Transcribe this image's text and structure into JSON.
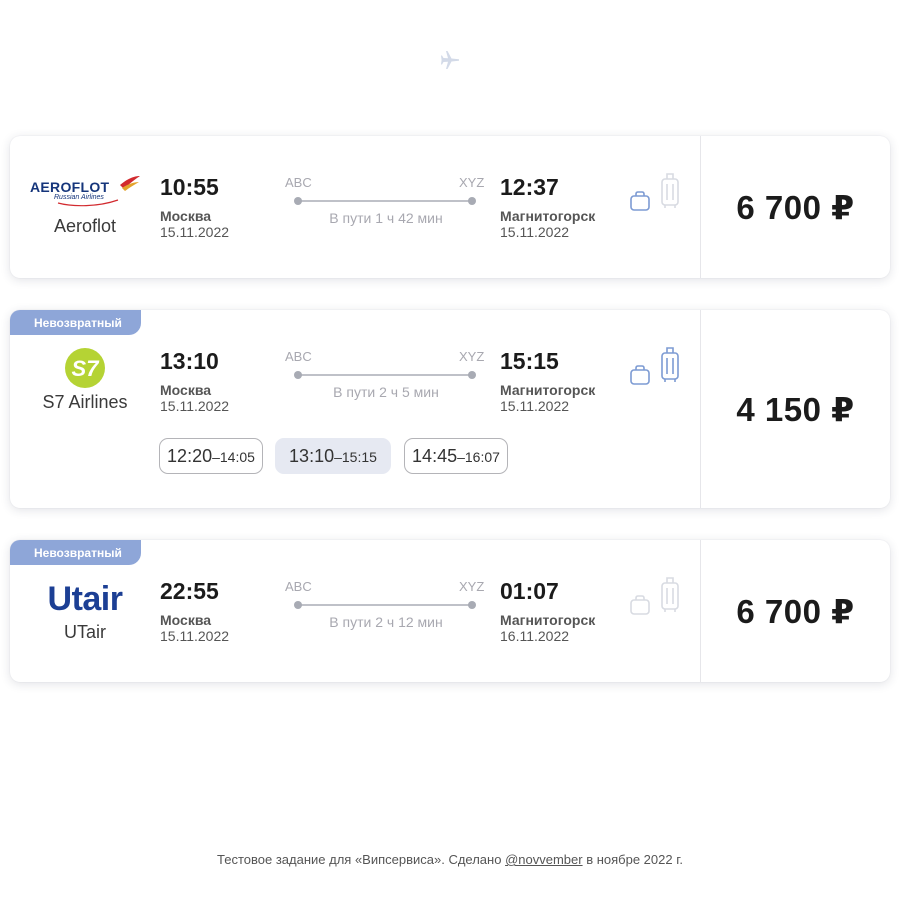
{
  "header": {
    "icon": "airplane-icon"
  },
  "flights": [
    {
      "airline": "Aeroflot",
      "logo": {
        "main": "AEROFLOT",
        "sub": "Russian Airlines"
      },
      "badge": "",
      "dep_time": "10:55",
      "dep_city": "Москва",
      "dep_date": "15.11.2022",
      "dep_code": "ABC",
      "arr_time": "12:37",
      "arr_city": "Магнитогорск",
      "arr_date": "15.11.2022",
      "arr_code": "XYZ",
      "duration": "В пути 1 ч 42 мин",
      "hand_luggage": true,
      "baggage": false,
      "price": "6 700 ₽"
    },
    {
      "airline": "S7 Airlines",
      "logo": {
        "main": "S7"
      },
      "badge": "Невозвратный",
      "dep_time": "13:10",
      "dep_city": "Москва",
      "dep_date": "15.11.2022",
      "dep_code": "ABC",
      "arr_time": "15:15",
      "arr_city": "Магнитогорск",
      "arr_date": "15.11.2022",
      "arr_code": "XYZ",
      "duration": "В пути 2 ч 5 мин",
      "hand_luggage": true,
      "baggage": true,
      "price": "4 150 ₽",
      "time_options": [
        {
          "dep": "12:20",
          "sep": "–",
          "arr": "14:05",
          "selected": false
        },
        {
          "dep": "13:10",
          "sep": "–",
          "arr": "15:15",
          "selected": true
        },
        {
          "dep": "14:45",
          "sep": "–",
          "arr": "16:07",
          "selected": false
        }
      ]
    },
    {
      "airline": "UTair",
      "logo": {
        "main": "Utair"
      },
      "badge": "Невозвратный",
      "dep_time": "22:55",
      "dep_city": "Москва",
      "dep_date": "15.11.2022",
      "dep_code": "ABC",
      "arr_time": "01:07",
      "arr_city": "Магнитогорск",
      "arr_date": "16.11.2022",
      "arr_code": "XYZ",
      "duration": "В пути 2 ч 12 мин",
      "hand_luggage": false,
      "baggage": false,
      "price": "6 700 ₽"
    }
  ],
  "footer": {
    "text_before": "Тестовое задание для «Випсервиса». Сделано ",
    "link": "@novvember",
    "text_after": " в ноябре 2022 г."
  },
  "colors": {
    "accent": "#8ea6d8",
    "icon_active": "#7d9bd3",
    "icon_inactive": "#d8dbe2",
    "s7_green": "#b5d334",
    "utair_blue": "#1c3f94"
  }
}
